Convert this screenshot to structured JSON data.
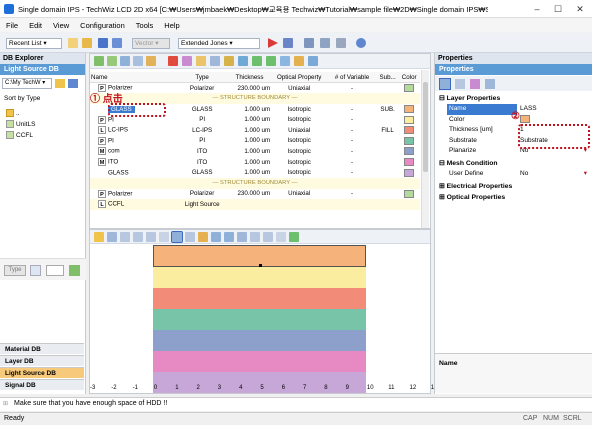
{
  "window": {
    "title": "Single domain IPS - TechWiz LCD 2D x64 [C:₩Users₩jmbaek₩Desktop₩교육용 Techwiz₩Tutorial₩sample file₩2D₩Single domain IPS₩Single domain IPS..."
  },
  "menu": [
    "File",
    "Edit",
    "View",
    "Configuration",
    "Tools",
    "Help"
  ],
  "toolbar": {
    "recent_list": "Recent List",
    "vector": "Vector",
    "jones": "Extended Jones"
  },
  "db_explorer": {
    "title": "DB Explorer",
    "header": "Light Source DB",
    "path": "C:\\My TechW",
    "sort_label": "Sort by Type",
    "tree": [
      "..",
      "UnitLS",
      "CCFL"
    ],
    "type_label": "Type",
    "tabs": [
      "Material DB",
      "Layer DB",
      "Light Source DB",
      "Signal DB"
    ]
  },
  "layer_table": {
    "headers": [
      "Name",
      "Type",
      "Thickness",
      "Optical Property",
      "# of Variable",
      "Sub...",
      "Color"
    ],
    "rows": [
      {
        "icon": "P",
        "name": "Polarizer",
        "type": "Polarizer",
        "thickness": "230.000 um",
        "optical": "Uniaxial",
        "var": "-",
        "sub": "",
        "color": "#b5d99c"
      },
      {
        "boundary": "— STRUCTURE BOUNDARY —"
      },
      {
        "icon": "",
        "name": "GLASS",
        "type": "GLASS",
        "thickness": "1.000 um",
        "optical": "Isotropic",
        "var": "-",
        "sub": "SUB.",
        "color": "#f5b27a"
      },
      {
        "icon": "P",
        "name": "PI",
        "type": "PI",
        "thickness": "1.000 um",
        "optical": "Isotropic",
        "var": "-",
        "sub": "",
        "color": "#fbeda0"
      },
      {
        "icon": "L",
        "name": "LC-IPS",
        "type": "LC-IPS",
        "thickness": "1.000 um",
        "optical": "Uniaxial",
        "var": "-",
        "sub": "FILL",
        "color": "#f28b78"
      },
      {
        "icon": "P",
        "name": "PI",
        "type": "PI",
        "thickness": "1.000 um",
        "optical": "Isotropic",
        "var": "-",
        "sub": "",
        "color": "#78c4a8"
      },
      {
        "icon": "M",
        "name": "com",
        "type": "ITO",
        "thickness": "1.000 um",
        "optical": "Isotropic",
        "var": "-",
        "sub": "",
        "color": "#8da0cb"
      },
      {
        "icon": "M",
        "name": "ITO",
        "type": "ITO",
        "thickness": "1.000 um",
        "optical": "Isotropic",
        "var": "-",
        "sub": "",
        "color": "#e78ac3"
      },
      {
        "icon": "",
        "name": "GLASS",
        "type": "GLASS",
        "thickness": "1.000 um",
        "optical": "Isotropic",
        "var": "-",
        "sub": "",
        "color": "#c7a6d8"
      },
      {
        "boundary": "— STRUCTURE BOUNDARY —"
      },
      {
        "icon": "P",
        "name": "Polarizer",
        "type": "Polarizer",
        "thickness": "230.000 um",
        "optical": "Uniaxial",
        "var": "-",
        "sub": "",
        "color": "#b5d99c"
      },
      {
        "icon": "L",
        "name": "CCFL",
        "type": "Light Source",
        "thickness": "",
        "optical": "",
        "var": "",
        "sub": "",
        "color": ""
      }
    ]
  },
  "annotation1": {
    "num": "①",
    "text": "点击"
  },
  "annotation2": {
    "num": "②"
  },
  "canvas": {
    "stripes": [
      "#f5b27a",
      "#fbeda0",
      "#f28b78",
      "#78c4a8",
      "#8da0cb",
      "#e78ac3",
      "#c7a6d8"
    ],
    "ticks": [
      "-3",
      "-2",
      "-1",
      "0",
      "1",
      "2",
      "3",
      "4",
      "5",
      "6",
      "7",
      "8",
      "9",
      "10",
      "11",
      "12",
      "13"
    ]
  },
  "properties": {
    "title": "Properties",
    "header": "Properties",
    "layer_section": "Layer Properties",
    "rows": [
      {
        "label": "Name",
        "value": "LASS"
      },
      {
        "label": "Color",
        "value": ""
      },
      {
        "label": "Thickness [um]",
        "value": "1"
      },
      {
        "label": "Substrate",
        "value": "Substrate"
      },
      {
        "label": "Planarize",
        "value": "No"
      }
    ],
    "mesh_section": "Mesh Condition",
    "user_define_label": "User Define",
    "user_define_value": "No",
    "electrical": "Electrical Properties",
    "optical": "Optical Properties",
    "footer": "Name"
  },
  "message": "Make sure that you have enough space of HDD !!",
  "status": {
    "ready": "Ready",
    "cap": "CAP",
    "num": "NUM",
    "scrl": "SCRL"
  }
}
